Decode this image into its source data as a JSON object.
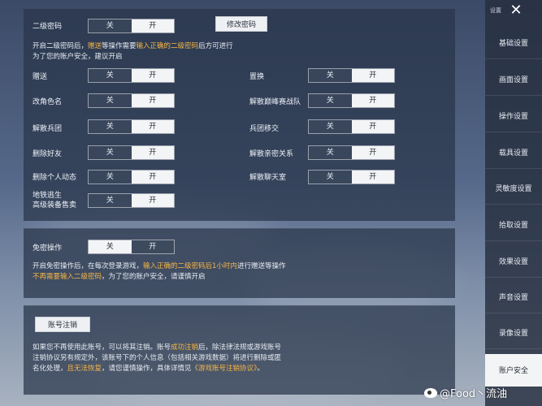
{
  "panel1": {
    "secondary_password": {
      "label": "二级密码",
      "off": "关",
      "on": "开",
      "value": "on"
    },
    "change_password_button": "修改密码",
    "desc_parts": [
      "开启二级密码后，",
      "赠送",
      "等操作需要",
      "输入正确的二级密码",
      "后方可进行"
    ],
    "desc_line2": "为了您的账户安全，建议开启",
    "left_rows": [
      {
        "label": "赠送",
        "value": "on"
      },
      {
        "label": "改角色名",
        "value": "on"
      },
      {
        "label": "解散兵团",
        "value": "on"
      },
      {
        "label": "删除好友",
        "value": "on"
      },
      {
        "label": "删除个人动态",
        "value": "on"
      },
      {
        "label_line1": "地铁逃生",
        "label_line2": "高级装备售卖",
        "value": "on"
      }
    ],
    "right_rows": [
      {
        "label": "置换",
        "value": "on"
      },
      {
        "label": "解散巅峰赛战队",
        "value": "on"
      },
      {
        "label": "兵团移交",
        "value": "on"
      },
      {
        "label": "解散亲密关系",
        "value": "on"
      },
      {
        "label": "解散聊天室",
        "value": "on"
      }
    ],
    "off_label": "关",
    "on_label": "开"
  },
  "panel2": {
    "label": "免密操作",
    "value": "off",
    "off_label": "关",
    "on_label": "开",
    "desc_l1_a": "开启免密操作后，在每次登录游戏，",
    "desc_l1_b": "输入正确的二级密码后1小时内",
    "desc_l1_c": "进行赠送等操作",
    "desc_l2_a": "不再需要输入二级密码",
    "desc_l2_b": "，为了您的账户安全，请谨慎开启"
  },
  "panel3": {
    "button": "账号注销",
    "l1_a": "如果您不再使用此账号，可以将其注销。账号",
    "l1_b": "成功注销",
    "l1_c": "后，除法律法规或游戏账号",
    "l2": "注销协议另有规定外，该账号下的个人信息（包括相关游戏数据）将进行删除或匿",
    "l3_a": "名化处理，",
    "l3_b": "且无法恢复",
    "l3_c": "，请您谨慎操作，具体详情见",
    "l3_d": "《游戏账号注销协议》",
    "l3_e": "。"
  },
  "sidebar": {
    "title": "设置",
    "items": [
      "基础设置",
      "画面设置",
      "操作设置",
      "载具设置",
      "灵敏度设置",
      "拾取设置",
      "效果设置",
      "声音设置",
      "录像设置",
      "账户安全"
    ],
    "active": "账户安全"
  },
  "watermark": "@Food丶流油",
  "colors": {
    "highlight": "#f5b545",
    "panel": "#28344a",
    "toggle_selected": "#f3f4f6"
  }
}
